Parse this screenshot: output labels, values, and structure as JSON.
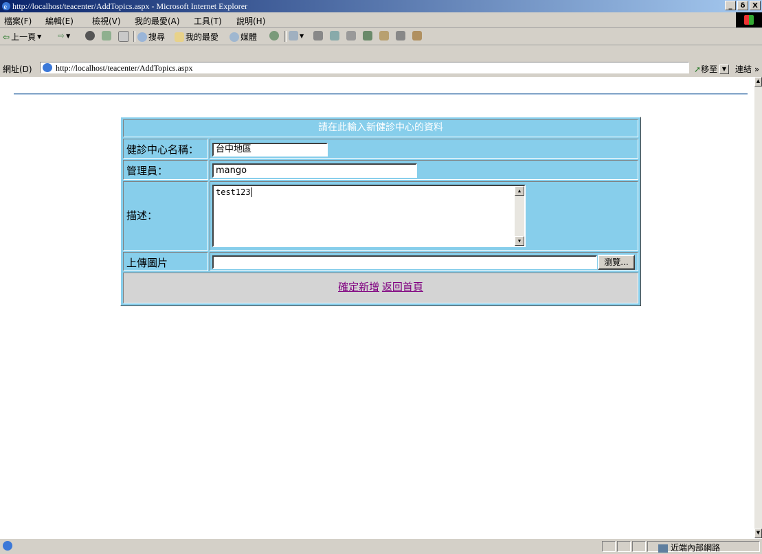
{
  "window": {
    "title": "http://localhost/teacenter/AddTopics.aspx - Microsoft Internet Explorer",
    "controls": [
      "_",
      "δ",
      "X"
    ]
  },
  "menu": [
    "檔案(F)",
    "編輯(E)",
    "檢視(V)",
    "我的最愛(A)",
    "工具(T)",
    "說明(H)"
  ],
  "toolbar": {
    "back": "上一頁",
    "search": "搜尋",
    "favorites": "我的最愛",
    "media": "媒體"
  },
  "address": {
    "label": "網址(D)",
    "url": "http://localhost/teacenter/AddTopics.aspx",
    "go": "移至",
    "links": "連結 »"
  },
  "form": {
    "header": "請在此輸入新健診中心的資料",
    "name_label": "健診中心名稱：",
    "name_value": "台中地區",
    "admin_label": "管理員：",
    "admin_value": "mango",
    "desc_label": "描述：",
    "desc_value": "test123",
    "upload_label": "上傳圖片",
    "upload_value": "",
    "browse": "瀏覽...",
    "submit_link": "確定新增",
    "home_link": "返回首頁"
  },
  "status": {
    "zone": "近端內部網路"
  },
  "colors": {
    "form_bg": "#87ceeb",
    "link": "#800080",
    "titlebar": "#0a246a"
  }
}
